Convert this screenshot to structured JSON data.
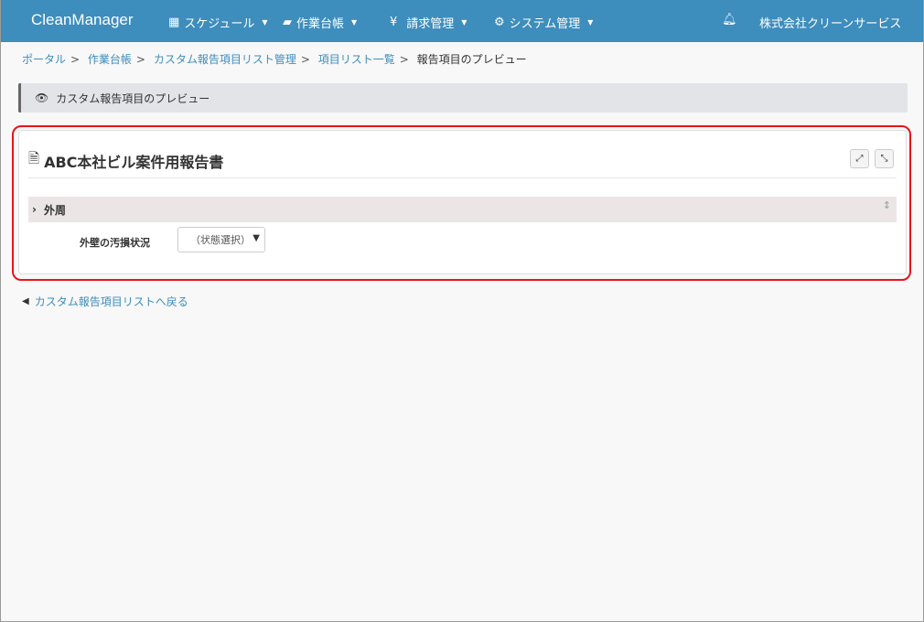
{
  "nav": {
    "brand": "CleanManager",
    "menus": [
      {
        "label": "スケジュール",
        "icon": "calendar-icon"
      },
      {
        "label": "作業台帳",
        "icon": "book-icon"
      },
      {
        "label": "請求管理",
        "icon": "yen-icon"
      },
      {
        "label": "システム管理",
        "icon": "gears-icon"
      }
    ],
    "company": "株式会社クリーンサービス"
  },
  "breadcrumb": [
    "ポータル",
    "作業台帳",
    "カスタム報告項目リスト管理",
    "項目リスト一覧",
    "報告項目のプレビュー"
  ],
  "page_title": "カスタム報告項目のプレビュー",
  "panel": {
    "title": "ABC本社ビル案件用報告書",
    "section": "外周",
    "field_label": "外壁の汚損状況",
    "select_value": "（状態選択）"
  },
  "back_link": "カスタム報告項目リストへ戻る"
}
